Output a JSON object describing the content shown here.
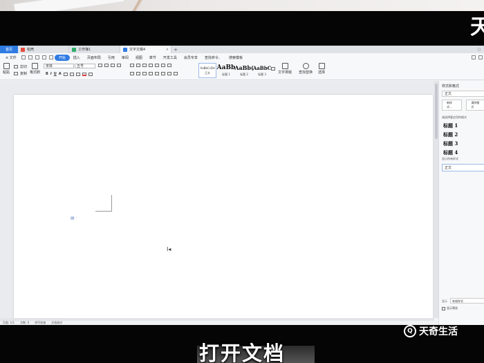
{
  "overlay": {
    "corner_text": "天",
    "caption": "打开文档",
    "watermark": "天奇生活",
    "watermark_logo": "Q"
  },
  "tabs": {
    "home": "首页",
    "items": [
      {
        "label": "稻壳",
        "color": "#e84b3c"
      },
      {
        "label": "工作簿1",
        "color": "#2fae6a"
      },
      {
        "label": "文字文稿4",
        "color": "#2f7be3"
      }
    ],
    "add": "+"
  },
  "menu": {
    "file": "≡ 文件",
    "items": [
      "开始",
      "插入",
      "页面布局",
      "引用",
      "审阅",
      "视图",
      "章节",
      "开发工具",
      "会员专享"
    ],
    "active": "开始",
    "search": "查找命令、",
    "search2": "搜索模板"
  },
  "ribbon": {
    "paste": "粘贴",
    "cut": "剪切",
    "copy": "复制",
    "format_painter": "格式刷",
    "font_name": "宋体",
    "font_size": "五号",
    "bold": "B",
    "italic": "I",
    "underline": "U",
    "strike": "A",
    "styles": [
      {
        "preview": "AaBbCcDd",
        "label": "正文"
      },
      {
        "preview": "AaBb",
        "label": "标题 1"
      },
      {
        "preview": "AaBb(",
        "label": "标题 2"
      },
      {
        "preview": "AaBbC",
        "label": "标题 3"
      }
    ],
    "text_layout": "文字排版",
    "find_replace": "查找替换",
    "select": "选择"
  },
  "panel": {
    "title": "样式和格式",
    "current_style": "正文",
    "new_style": "新样式...",
    "clear_format": "清除格式",
    "headings_title": "请选择要应用的格式",
    "headings": [
      "标题  1",
      "标题  2",
      "标题  3",
      "标题  4"
    ],
    "all_styles_title": "显示所有样式",
    "current_style2": "正文",
    "show_label": "显示",
    "show_value": "有效样式",
    "preview": "显示预览"
  },
  "status": {
    "page": "页面: 1/1",
    "words": "字数: 0",
    "spell": "拼写检查",
    "doc_check": "文档校对"
  }
}
